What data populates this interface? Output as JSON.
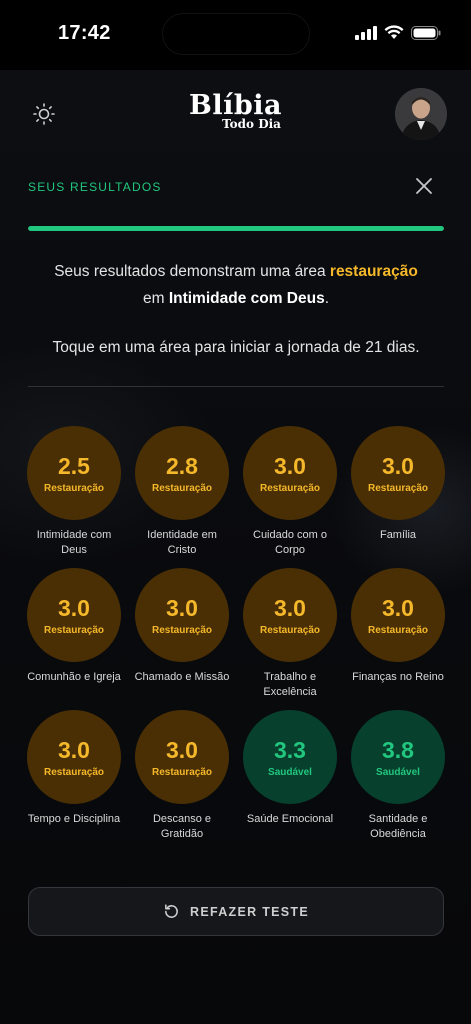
{
  "status_bar": {
    "time": "17:42"
  },
  "header": {
    "logo_main": "Blíbia",
    "logo_sub": "Todo Dia",
    "theme_icon": "sun-icon",
    "avatar_icon": "user-avatar"
  },
  "results": {
    "label": "SEUS RESULTADOS",
    "close_icon": "close-icon",
    "progress": 1.0,
    "summary_prefix": "Seus resultados demonstram uma área",
    "summary_highlight": "restauração",
    "summary_middle": "em",
    "summary_area": "Intimidade com Deus",
    "summary_suffix": ".",
    "instruction": "Toque em uma área para iniciar a jornada de 21 dias."
  },
  "areas": [
    {
      "score": "2.5",
      "status": "Restauração",
      "name": "Intimidade com Deus",
      "kind": "rest"
    },
    {
      "score": "2.8",
      "status": "Restauração",
      "name": "Identidade em Cristo",
      "kind": "rest"
    },
    {
      "score": "3.0",
      "status": "Restauração",
      "name": "Cuidado com o Corpo",
      "kind": "rest"
    },
    {
      "score": "3.0",
      "status": "Restauração",
      "name": "Família",
      "kind": "rest"
    },
    {
      "score": "3.0",
      "status": "Restauração",
      "name": "Comunhão e Igreja",
      "kind": "rest"
    },
    {
      "score": "3.0",
      "status": "Restauração",
      "name": "Chamado e Missão",
      "kind": "rest"
    },
    {
      "score": "3.0",
      "status": "Restauração",
      "name": "Trabalho e Excelência",
      "kind": "rest"
    },
    {
      "score": "3.0",
      "status": "Restauração",
      "name": "Finanças no Reino",
      "kind": "rest"
    },
    {
      "score": "3.0",
      "status": "Restauração",
      "name": "Tempo e Disciplina",
      "kind": "rest"
    },
    {
      "score": "3.0",
      "status": "Restauração",
      "name": "Descanso e Gratidão",
      "kind": "rest"
    },
    {
      "score": "3.3",
      "status": "Saudável",
      "name": "Saúde Emocional",
      "kind": "saud"
    },
    {
      "score": "3.8",
      "status": "Saudável",
      "name": "Santidade e Obediência",
      "kind": "saud"
    }
  ],
  "redo_button": {
    "label": "REFAZER TESTE",
    "icon": "redo-icon"
  },
  "colors": {
    "accent_green": "#22c77f",
    "accent_gold": "#f5b82a",
    "restoration_bg": "#4a2f05",
    "healthy_bg": "#07402d"
  }
}
